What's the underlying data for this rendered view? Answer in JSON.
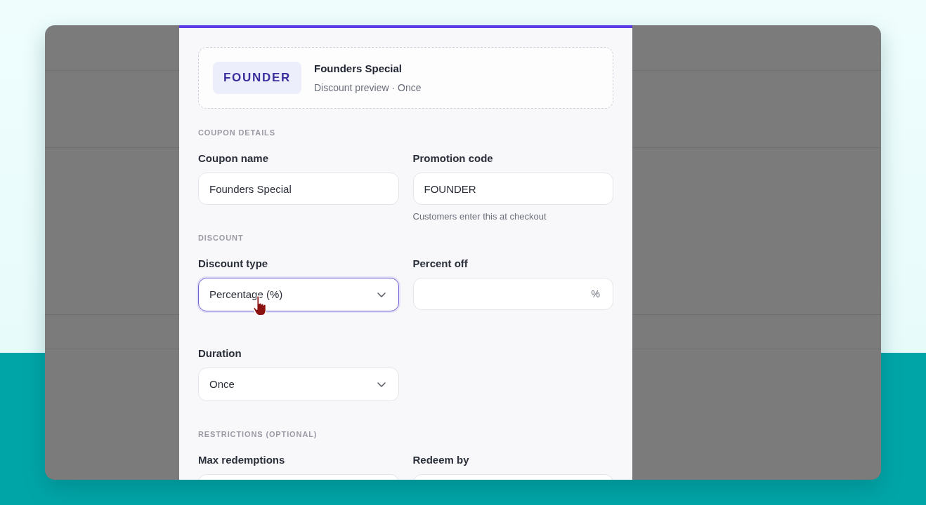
{
  "preview": {
    "badge": "FOUNDER",
    "title": "Founders Special",
    "subtitle": "Discount preview · Once"
  },
  "sections": [
    {
      "heading": "COUPON DETAILS",
      "fields": [
        {
          "kind": "input",
          "label": "Coupon name",
          "value": "Founders Special",
          "focused": false
        },
        {
          "kind": "input",
          "label": "Promotion code",
          "value": "FOUNDER",
          "focused": false,
          "help": "Customers enter this at checkout"
        }
      ]
    },
    {
      "heading": "DISCOUNT",
      "fields": [
        {
          "kind": "select",
          "label": "Discount type",
          "value": "Percentage (%)",
          "focused": true
        },
        {
          "kind": "input",
          "label": "Percent off",
          "suffix": "%",
          "focused": false
        },
        {
          "kind": "select",
          "label": "Duration",
          "value": "Once",
          "focused": false
        }
      ]
    },
    {
      "heading": "RESTRICTIONS (OPTIONAL)",
      "fields": [
        {
          "kind": "input",
          "label": "Max redemptions",
          "focused": false
        },
        {
          "kind": "input",
          "label": "Redeem by",
          "focused": false
        }
      ]
    }
  ]
}
